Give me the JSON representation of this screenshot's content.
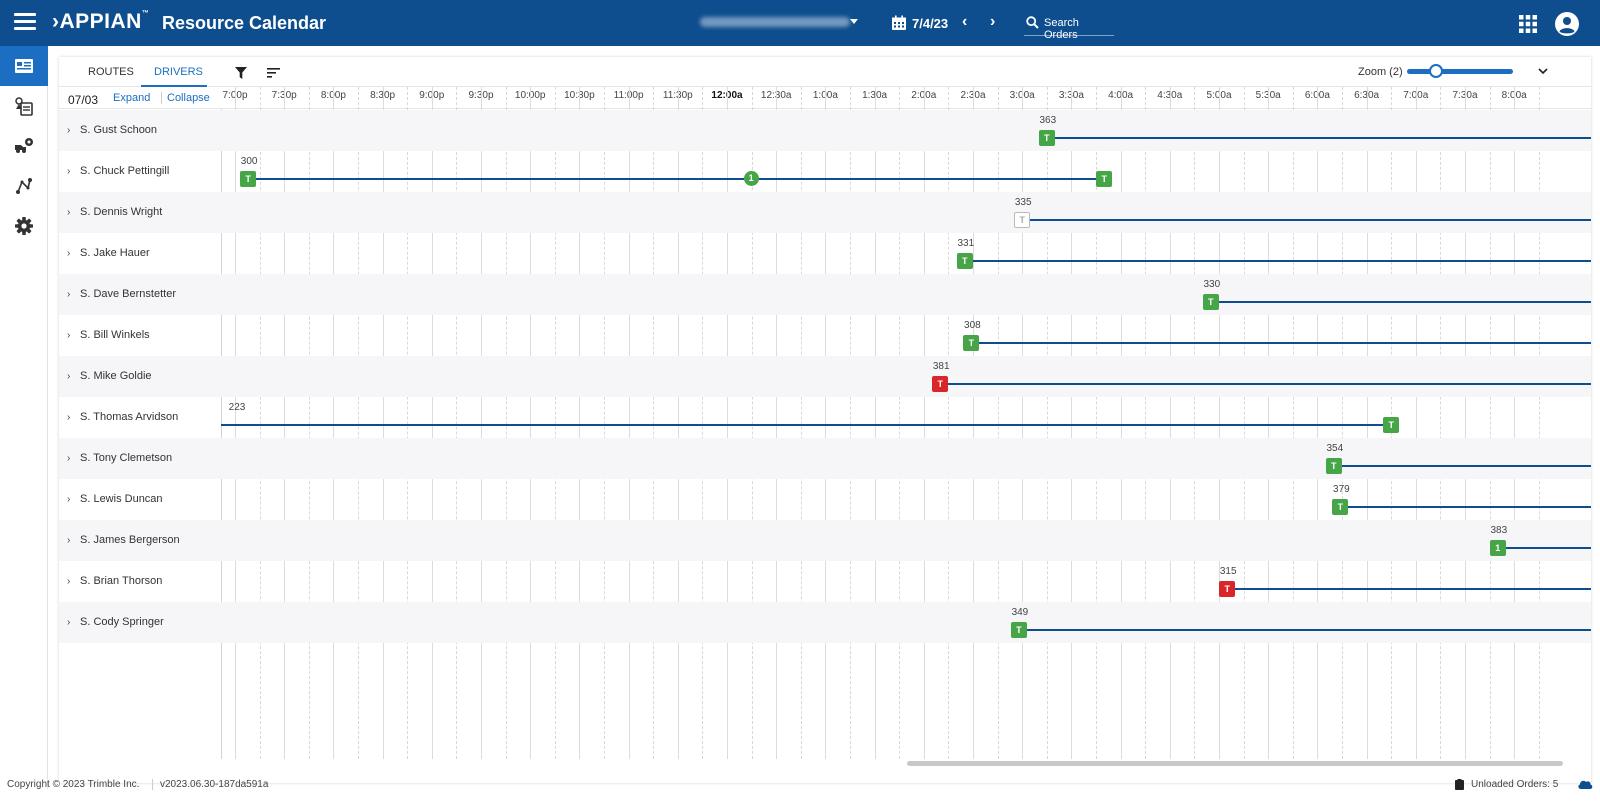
{
  "header": {
    "logo_text": "APPIAN",
    "logo_mark": "™",
    "title": "Resource Calendar",
    "date": "7/4/23",
    "search_placeholder": "Search Orders"
  },
  "colors": {
    "header_bg": "#0e4e8e",
    "accent": "#1b6ec2",
    "route_line": "#0e4e8e",
    "marker_green": "#46a546",
    "marker_red": "#d9262a"
  },
  "left_nav": {
    "items": [
      {
        "icon": "calendar-card-icon",
        "active": true
      },
      {
        "icon": "orders-icon",
        "active": false
      },
      {
        "icon": "fleet-icon",
        "active": false
      },
      {
        "icon": "routes-icon",
        "active": false
      },
      {
        "icon": "gear-icon",
        "active": false
      }
    ]
  },
  "toolbar": {
    "tab_routes": "ROUTES",
    "tab_drivers": "DRIVERS",
    "zoom_label": "Zoom (2)",
    "zoom_level": 2
  },
  "timeline": {
    "date": "07/03",
    "expand": "Expand",
    "collapse": "Collapse",
    "times": [
      "7:00p",
      "7:30p",
      "8:00p",
      "8:30p",
      "9:00p",
      "9:30p",
      "10:00p",
      "10:30p",
      "11:00p",
      "11:30p",
      "12:00a",
      "12:30a",
      "1:00a",
      "1:30a",
      "2:00a",
      "2:30a",
      "3:00a",
      "3:30a",
      "4:00a",
      "4:30a",
      "5:00a",
      "5:30a",
      "6:00a",
      "6:30a",
      "7:00a",
      "7:30a",
      "8:00a"
    ],
    "bold_time": "12:00a"
  },
  "drivers": [
    {
      "name": "S. Gust Schoon",
      "route": "363",
      "start": "3:15a",
      "start_marker": "T",
      "start_color": "green",
      "end_marker": null
    },
    {
      "name": "S. Chuck Pettingill",
      "route": "300",
      "start": "7:08p",
      "start_marker": "T",
      "start_color": "green",
      "mid_marker": "1",
      "mid": "12:15a",
      "end": "3:50a",
      "end_marker": "T",
      "end_color": "green"
    },
    {
      "name": "S. Dennis Wright",
      "route": "335",
      "start": "3:00a",
      "start_marker": "T",
      "start_color": "white",
      "end_marker": null
    },
    {
      "name": "S. Jake Hauer",
      "route": "331",
      "start": "2:25a",
      "start_marker": "T",
      "start_color": "green",
      "end_marker": null
    },
    {
      "name": "S. Dave Bernstetter",
      "route": "330",
      "start": "4:55a",
      "start_marker": "T",
      "start_color": "green",
      "end_marker": null
    },
    {
      "name": "S. Bill Winkels",
      "route": "308",
      "start": "2:29a",
      "start_marker": "T",
      "start_color": "green",
      "end_marker": null
    },
    {
      "name": "S. Mike Goldie",
      "route": "381",
      "start": "2:10a",
      "start_marker": "T",
      "start_color": "red",
      "end_marker": null
    },
    {
      "name": "S. Thomas Arvidson",
      "route": "223",
      "start": "6:50p",
      "end": "6:45a",
      "end_marker": "T",
      "end_color": "green"
    },
    {
      "name": "S. Tony Clemetson",
      "route": "354",
      "start": "6:10a",
      "start_marker": "T",
      "start_color": "green",
      "end_marker": null
    },
    {
      "name": "S. Lewis Duncan",
      "route": "379",
      "start": "6:14a",
      "start_marker": "T",
      "start_color": "green",
      "end_marker": null
    },
    {
      "name": "S. James Bergerson",
      "route": "383",
      "start": "7:50a",
      "start_marker": "1",
      "start_color": "green",
      "end_marker": null
    },
    {
      "name": "S. Brian Thorson",
      "route": "315",
      "start": "5:05a",
      "start_marker": "T",
      "start_color": "red",
      "end_marker": null
    },
    {
      "name": "S. Cody Springer",
      "route": "349",
      "start": "2:58a",
      "start_marker": "T",
      "start_color": "green",
      "end_marker": null
    }
  ],
  "footer": {
    "copyright": "Copyright © 2023 Trimble Inc.",
    "version": "v2023.06.30-187da591a",
    "unloaded": "Unloaded Orders: 5"
  }
}
